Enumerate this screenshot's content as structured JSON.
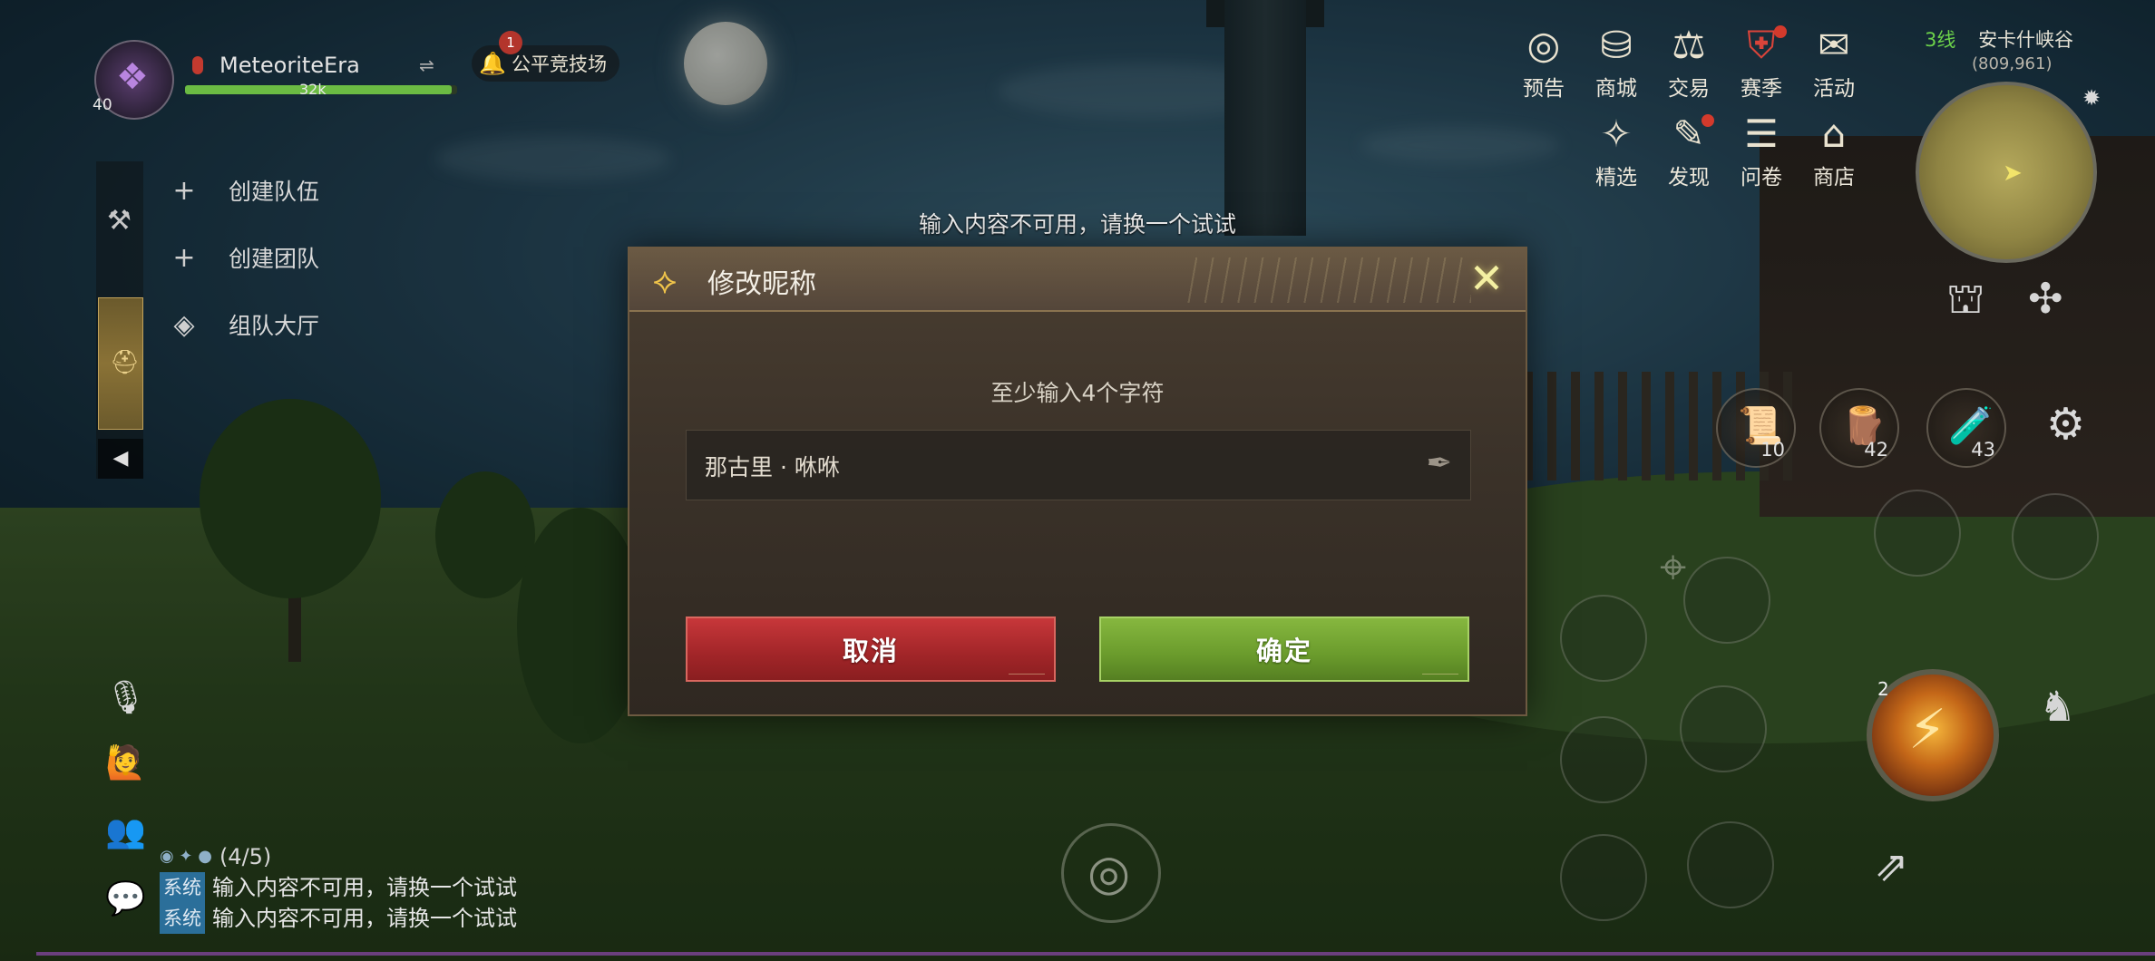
{
  "player": {
    "name": "MeteoriteEra",
    "level": "40",
    "hp_text": "32k",
    "hp_fraction": 0.98
  },
  "arena": {
    "label": "公平竞技场",
    "badge": "1"
  },
  "team_menu": {
    "items": [
      {
        "label": "创建队伍",
        "icon": "plus-icon"
      },
      {
        "label": "创建团队",
        "icon": "plus-icon"
      },
      {
        "label": "组队大厅",
        "icon": "diamond-icon"
      }
    ]
  },
  "top_menu": {
    "row1": [
      {
        "label": "预告",
        "icon": "preview-icon",
        "dot": false
      },
      {
        "label": "商城",
        "icon": "mall-icon",
        "dot": false
      },
      {
        "label": "交易",
        "icon": "trade-icon",
        "dot": false
      },
      {
        "label": "赛季",
        "icon": "season-icon",
        "dot": true
      },
      {
        "label": "活动",
        "icon": "event-icon",
        "dot": false
      }
    ],
    "row2": [
      {
        "label": "精选",
        "icon": "featured-icon",
        "dot": false
      },
      {
        "label": "发现",
        "icon": "discover-icon",
        "dot": true
      },
      {
        "label": "问卷",
        "icon": "survey-icon",
        "dot": false
      },
      {
        "label": "商店",
        "icon": "shop-icon",
        "dot": false
      }
    ]
  },
  "location": {
    "line": "3线",
    "zone": "安卡什峡谷",
    "coords": "(809,961)"
  },
  "items": [
    {
      "count": "10",
      "icon": "scroll-icon"
    },
    {
      "count": "42",
      "icon": "bundle-icon"
    },
    {
      "count": "43",
      "icon": "potion-icon"
    }
  ],
  "skill": {
    "charges": "2"
  },
  "chat": {
    "party_count": "(4/5)",
    "tag": "系统",
    "messages": [
      "输入内容不可用，请换一个试试",
      "输入内容不可用，请换一个试试"
    ]
  },
  "toast": "输入内容不可用，请换一个试试",
  "dialog": {
    "title": "修改昵称",
    "hint": "至少输入4个字符",
    "name_value": "那古里 · 咻咻",
    "cancel_label": "取消",
    "confirm_label": "确定"
  },
  "colors": {
    "cancel": "#a12528",
    "confirm": "#6a9b2c",
    "hp": "#6bbb43",
    "accent_gold": "#f0c44a"
  }
}
